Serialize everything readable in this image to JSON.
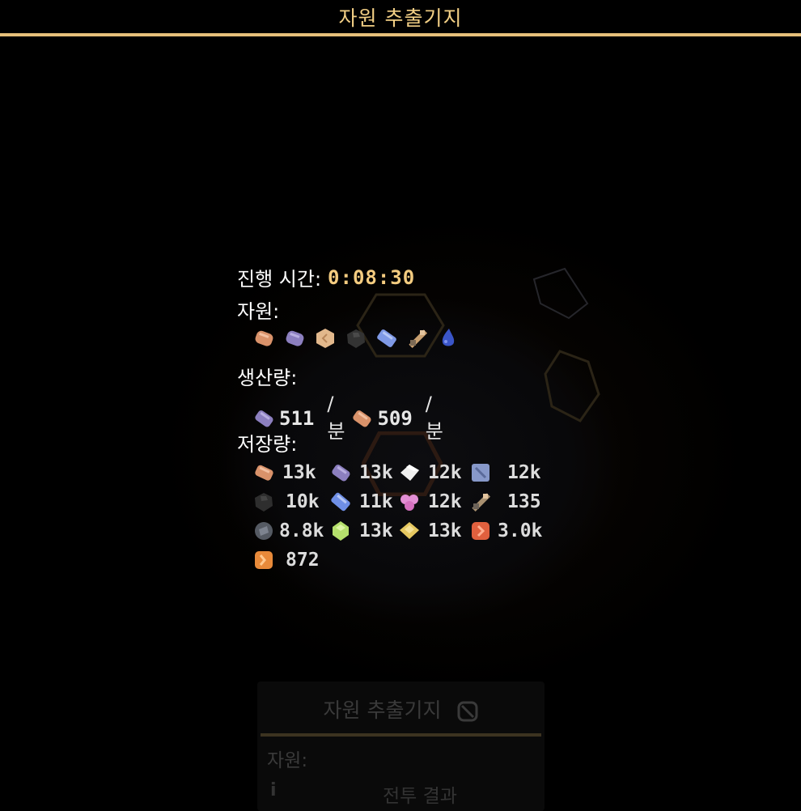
{
  "title": "자원 추출기지",
  "info": {
    "elapsed_label": "진행 시간:",
    "elapsed_value": "0:08:30",
    "resources_label": "자원:",
    "production_label": "생산량:",
    "storage_label": "저장량:"
  },
  "resources": [
    {
      "icon": "copper-ore-icon",
      "color": "#d9926a"
    },
    {
      "icon": "lead-ore-icon",
      "color": "#8c7fbf"
    },
    {
      "icon": "sand-icon",
      "color": "#e2b88c"
    },
    {
      "icon": "coal-icon",
      "color": "#333333"
    },
    {
      "icon": "titanium-icon",
      "color": "#7f99e6"
    },
    {
      "icon": "scrap-icon",
      "color": "#c9a070"
    },
    {
      "icon": "water-icon",
      "color": "#3a55c8"
    }
  ],
  "production": [
    {
      "icon": "lead-icon",
      "value": "511",
      "unit": "/분"
    },
    {
      "icon": "copper-icon",
      "value": "509",
      "unit": "/분"
    }
  ],
  "storage": [
    {
      "icon": "copper-icon",
      "value": "13k"
    },
    {
      "icon": "lead-icon",
      "value": "13k"
    },
    {
      "icon": "metaglass-icon",
      "value": "12k"
    },
    {
      "icon": "graphite-icon",
      "value": "12k"
    },
    {
      "icon": "coal-icon",
      "value": "10k"
    },
    {
      "icon": "titanium-icon",
      "value": "11k"
    },
    {
      "icon": "spore-pod-icon",
      "value": "12k"
    },
    {
      "icon": "scrap-icon",
      "value": "135"
    },
    {
      "icon": "silicon-icon",
      "value": "8.8k"
    },
    {
      "icon": "phase-fabric-icon",
      "value": "13k"
    },
    {
      "icon": "plastanium-icon",
      "value": "13k"
    },
    {
      "icon": "surge-alloy-icon",
      "value": "3.0k"
    },
    {
      "icon": "blast-compound-icon",
      "value": "872"
    }
  ],
  "ghost_panel": {
    "title": "자원 추출기지",
    "resources_label": "자원:",
    "result_label": "전투 결과",
    "info_glyph": "i"
  }
}
